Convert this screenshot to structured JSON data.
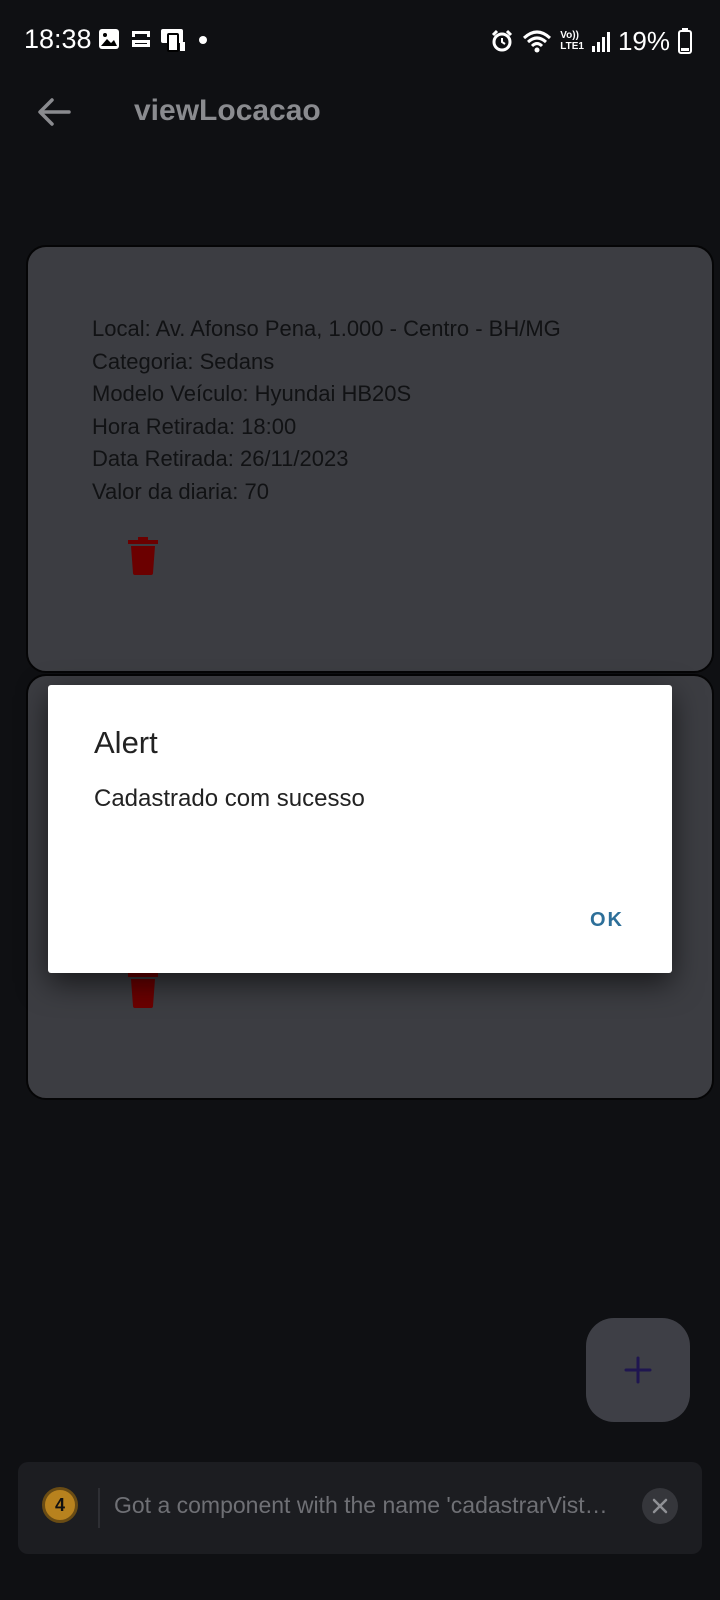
{
  "status_bar": {
    "time": "18:38",
    "battery": "19%",
    "network_label_top": "Vo))",
    "network_label_bottom": "LTE1",
    "icons": [
      "image-icon",
      "cast-icon",
      "device-icon",
      "dot-icon",
      "alarm-icon",
      "wifi-icon",
      "signal-icon",
      "battery-icon"
    ]
  },
  "header": {
    "title": "viewLocacao",
    "back_icon": "arrow-left-icon"
  },
  "cards": [
    {
      "lines": [
        "Local: Av. Afonso Pena, 1.000 - Centro - BH/MG",
        "Categoria: Sedans",
        "Modelo Veículo: Hyundai HB20S",
        "Hora Retirada: 18:00",
        "Data Retirada: 26/11/2023",
        "Valor da diaria: 70"
      ],
      "delete_icon": "trash-icon"
    },
    {
      "lines": [],
      "delete_icon": "trash-icon"
    }
  ],
  "dialog": {
    "title": "Alert",
    "message": "Cadastrado com sucesso",
    "ok_label": "OK"
  },
  "fab": {
    "icon": "plus-icon"
  },
  "toast": {
    "count": "4",
    "message": "Got a component with the name 'cadastrarVist…",
    "dismiss_icon": "close-icon"
  },
  "colors": {
    "background": "#0f1013",
    "card": "#3c3d42",
    "dialog": "#ffffff",
    "accent": "#2d6f99",
    "delete": "#6b0000",
    "fab_icon": "#1f1650"
  }
}
